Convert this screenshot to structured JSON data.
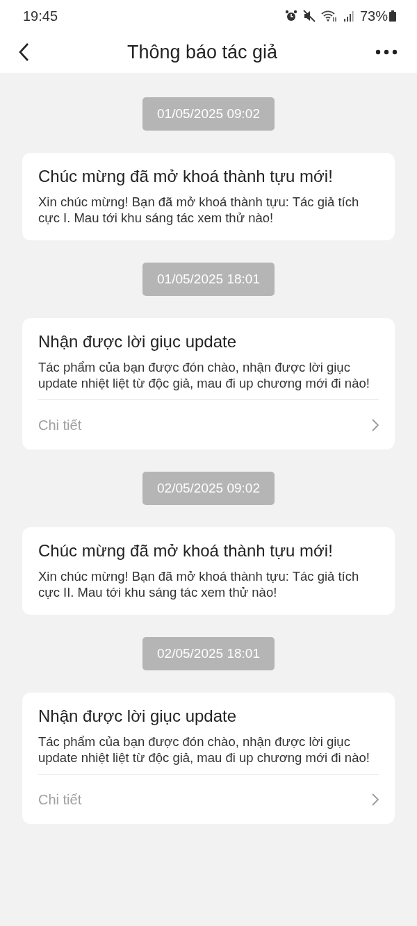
{
  "status_bar": {
    "time": "19:45",
    "battery": "73%"
  },
  "header": {
    "title": "Thông báo tác giả"
  },
  "notifications": [
    {
      "time": "01/05/2025 09:02",
      "title": "Chúc mừng đã mở khoá thành tựu mới!",
      "body": "Xin chúc mừng! Bạn đã mở khoá thành tựu: Tác giả tích cực I. Mau tới khu sáng tác xem thử nào!"
    },
    {
      "time": "01/05/2025 18:01",
      "title": "Nhận được lời giục update",
      "body": "Tác phẩm của bạn được đón chào, nhận được lời giục update nhiệt liệt từ độc giả, mau đi up chương mới đi nào!",
      "link": "Chi tiết"
    },
    {
      "time": "02/05/2025 09:02",
      "title": "Chúc mừng đã mở khoá thành tựu mới!",
      "body": "Xin chúc mừng! Bạn đã mở khoá thành tựu: Tác giả tích cực II. Mau tới khu sáng tác xem thử nào!"
    },
    {
      "time": "02/05/2025 18:01",
      "title": "Nhận được lời giục update",
      "body": "Tác phẩm của bạn được đón chào, nhận được lời giục update nhiệt liệt từ độc giả, mau đi up chương mới đi nào!",
      "link": "Chi tiết"
    }
  ]
}
